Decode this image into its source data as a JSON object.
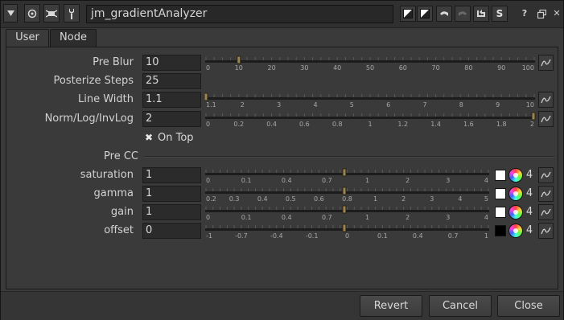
{
  "title": "jm_gradientAnalyzer",
  "right_buttons": [
    "S"
  ],
  "window_buttons": [
    "?",
    "□",
    "✕"
  ],
  "tabs": [
    "User",
    "Node"
  ],
  "knobs": [
    {
      "label": "Pre Blur",
      "value": "10",
      "ticks": [
        "0",
        "10",
        "20",
        "30",
        "40",
        "50",
        "60",
        "70",
        "80",
        "90",
        "100"
      ],
      "fraction": 0.1
    },
    {
      "label": "Posterize Steps",
      "value": "25"
    },
    {
      "label": "Line Width",
      "value": "1.1",
      "ticks": [
        "1.1",
        "2",
        "3",
        "4",
        "5",
        "6",
        "7",
        "8",
        "9",
        "10"
      ],
      "fraction": 0.0
    },
    {
      "label": "Norm/Log/InvLog",
      "value": "2",
      "ticks": [
        "0",
        "0.2",
        "0.4",
        "0.6",
        "0.8",
        "1",
        "1.2",
        "1.4",
        "1.6",
        "1.8",
        "2"
      ],
      "fraction": 1.0
    }
  ],
  "on_top": {
    "label": "On Top",
    "checked": true
  },
  "pre_cc_label": "Pre CC",
  "cc_knobs": [
    {
      "label": "saturation",
      "value": "1",
      "ticks": [
        "0",
        "0.1",
        "0.4",
        "0.7",
        "1",
        "2",
        "3",
        "4"
      ],
      "channels": "4",
      "swatch": "#ffffff"
    },
    {
      "label": "gamma",
      "value": "1",
      "ticks": [
        "0.2",
        "0.3",
        "0.4",
        "0.5",
        "0.6",
        "0.8",
        "1",
        "2",
        "3",
        "4",
        "5"
      ],
      "channels": "4",
      "swatch": "#ffffff"
    },
    {
      "label": "gain",
      "value": "1",
      "ticks": [
        "0",
        "0.1",
        "0.4",
        "0.7",
        "1",
        "2",
        "3",
        "4"
      ],
      "channels": "4",
      "swatch": "#ffffff"
    },
    {
      "label": "offset",
      "value": "0",
      "ticks": [
        "-1",
        "-0.7",
        "-0.4",
        "-0.1",
        "0",
        "0.1",
        "0.4",
        "0.7",
        "1"
      ],
      "channels": "4",
      "swatch": "#000000"
    }
  ],
  "footer": {
    "revert": "Revert",
    "cancel": "Cancel",
    "close": "Close"
  }
}
